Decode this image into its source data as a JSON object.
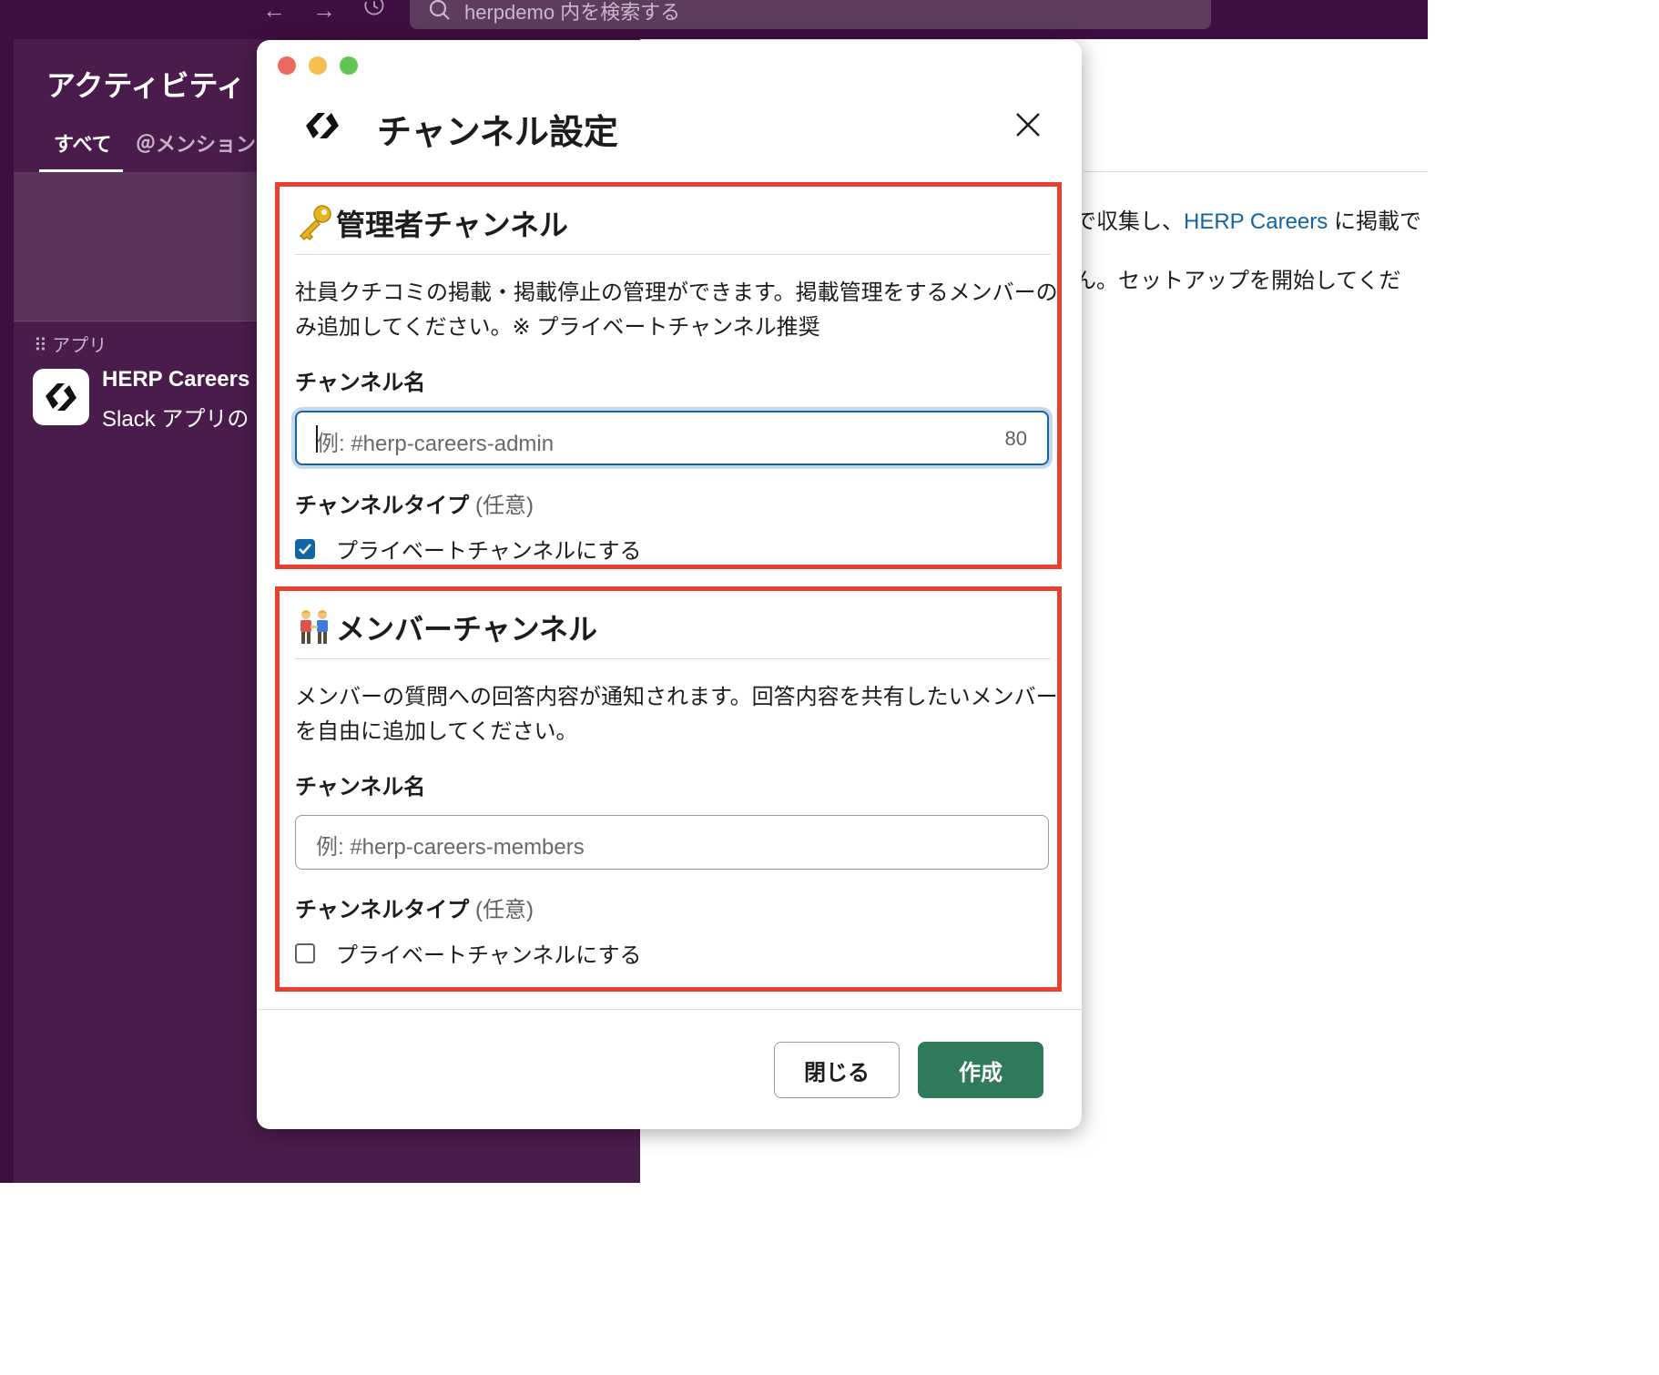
{
  "toolbar": {
    "back_icon": "arrow-left-icon",
    "forward_icon": "arrow-right-icon",
    "history_icon": "history-icon",
    "search_placeholder": "herpdemo 内を検索する"
  },
  "sidebar": {
    "title": "アクティビティ",
    "tabs": [
      {
        "label": "すべて",
        "selected": true
      },
      {
        "label": "＠メンション",
        "selected": false
      }
    ],
    "section_label": "アプリ",
    "app": {
      "name": "HERP Careers",
      "subtitle": "Slack アプリの"
    }
  },
  "background_message": {
    "line1_prefix": "で収集し、",
    "line1_link": "HERP Careers",
    "line1_suffix": " に掲載で",
    "line2": "ん。セットアップを開始してくだ"
  },
  "modal": {
    "title": "チャンネル設定",
    "close_icon": "close-icon",
    "admin_section": {
      "emoji": "key-icon",
      "heading": "管理者チャンネル",
      "description": "社員クチコミの掲載・掲載停止の管理ができます。掲載管理をするメンバーのみ追加してください。※ プライベートチャンネル推奨",
      "channel_name_label": "チャンネル名",
      "channel_name_placeholder": "例: #herp-careers-admin",
      "channel_name_value": "",
      "char_count": "80",
      "channel_type_label": "チャンネルタイプ",
      "channel_type_optional": "(任意)",
      "private_checkbox_label": "プライベートチャンネルにする",
      "private_checked": true
    },
    "member_section": {
      "emoji": "two-men-holding-hands-icon",
      "heading": "メンバーチャンネル",
      "description": "メンバーの質問への回答内容が通知されます。回答内容を共有したいメンバーを自由に追加してください。",
      "channel_name_label": "チャンネル名",
      "channel_name_placeholder": "例: #herp-careers-members",
      "channel_name_value": "",
      "channel_type_label": "チャンネルタイプ",
      "channel_type_optional": "(任意)",
      "private_checkbox_label": "プライベートチャンネルにする",
      "private_checked": false
    },
    "buttons": {
      "close_label": "閉じる",
      "create_label": "作成"
    }
  },
  "colors": {
    "sidebar_bg": "#4a1c4b",
    "topbar_bg": "#3f0e40",
    "highlight_border": "#e8402e",
    "primary_button": "#2f7a5a",
    "link": "#1264a3"
  }
}
